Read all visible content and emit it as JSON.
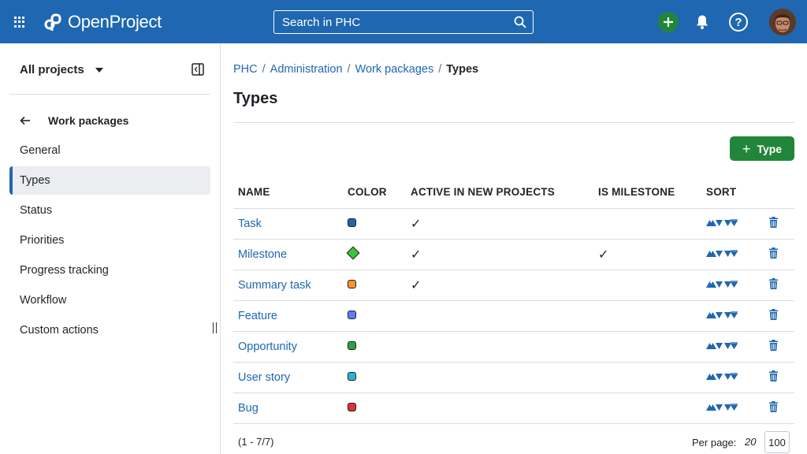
{
  "header": {
    "app_name": "OpenProject",
    "search": {
      "placeholder": "Search in PHC",
      "value": ""
    },
    "icons": [
      "grid-menu-icon",
      "search-icon",
      "plus-icon",
      "bell-icon",
      "help-icon",
      "avatar"
    ],
    "help_glyph": "?",
    "colors": {
      "bar": "#1f67b1",
      "add": "#21863a"
    }
  },
  "sidebar": {
    "project_selector": "All projects",
    "back_label": "Work packages",
    "items": [
      {
        "label": "General",
        "active": false
      },
      {
        "label": "Types",
        "active": true
      },
      {
        "label": "Status",
        "active": false
      },
      {
        "label": "Priorities",
        "active": false
      },
      {
        "label": "Progress tracking",
        "active": false
      },
      {
        "label": "Workflow",
        "active": false
      },
      {
        "label": "Custom actions",
        "active": false
      }
    ]
  },
  "breadcrumb": {
    "items": [
      "PHC",
      "Administration",
      "Work packages"
    ],
    "separator": "/",
    "current": "Types"
  },
  "page": {
    "title": "Types",
    "add_button_label": "Type",
    "add_button_glyph": "+"
  },
  "table": {
    "headers": [
      "NAME",
      "COLOR",
      "ACTIVE IN NEW PROJECTS",
      "IS MILESTONE",
      "SORT"
    ],
    "check_glyph": "✓",
    "rows": [
      {
        "name": "Task",
        "color": "#1a66b0",
        "shape": "square",
        "active": true,
        "milestone": false
      },
      {
        "name": "Milestone",
        "color": "#35c53f",
        "shape": "diamond",
        "active": true,
        "milestone": true
      },
      {
        "name": "Summary task",
        "color": "#ff922b",
        "shape": "square",
        "active": true,
        "milestone": false
      },
      {
        "name": "Feature",
        "color": "#5c7cfa",
        "shape": "square",
        "active": false,
        "milestone": false
      },
      {
        "name": "Opportunity",
        "color": "#2f9e44",
        "shape": "square",
        "active": false,
        "milestone": false
      },
      {
        "name": "User story",
        "color": "#22b8cf",
        "shape": "square",
        "active": false,
        "milestone": false
      },
      {
        "name": "Bug",
        "color": "#e03131",
        "shape": "square",
        "active": false,
        "milestone": false
      }
    ]
  },
  "pagination": {
    "count": "(1 - 7/7)",
    "per_page_label": "Per page:",
    "options": [
      "20",
      "100"
    ],
    "selected": "100"
  }
}
